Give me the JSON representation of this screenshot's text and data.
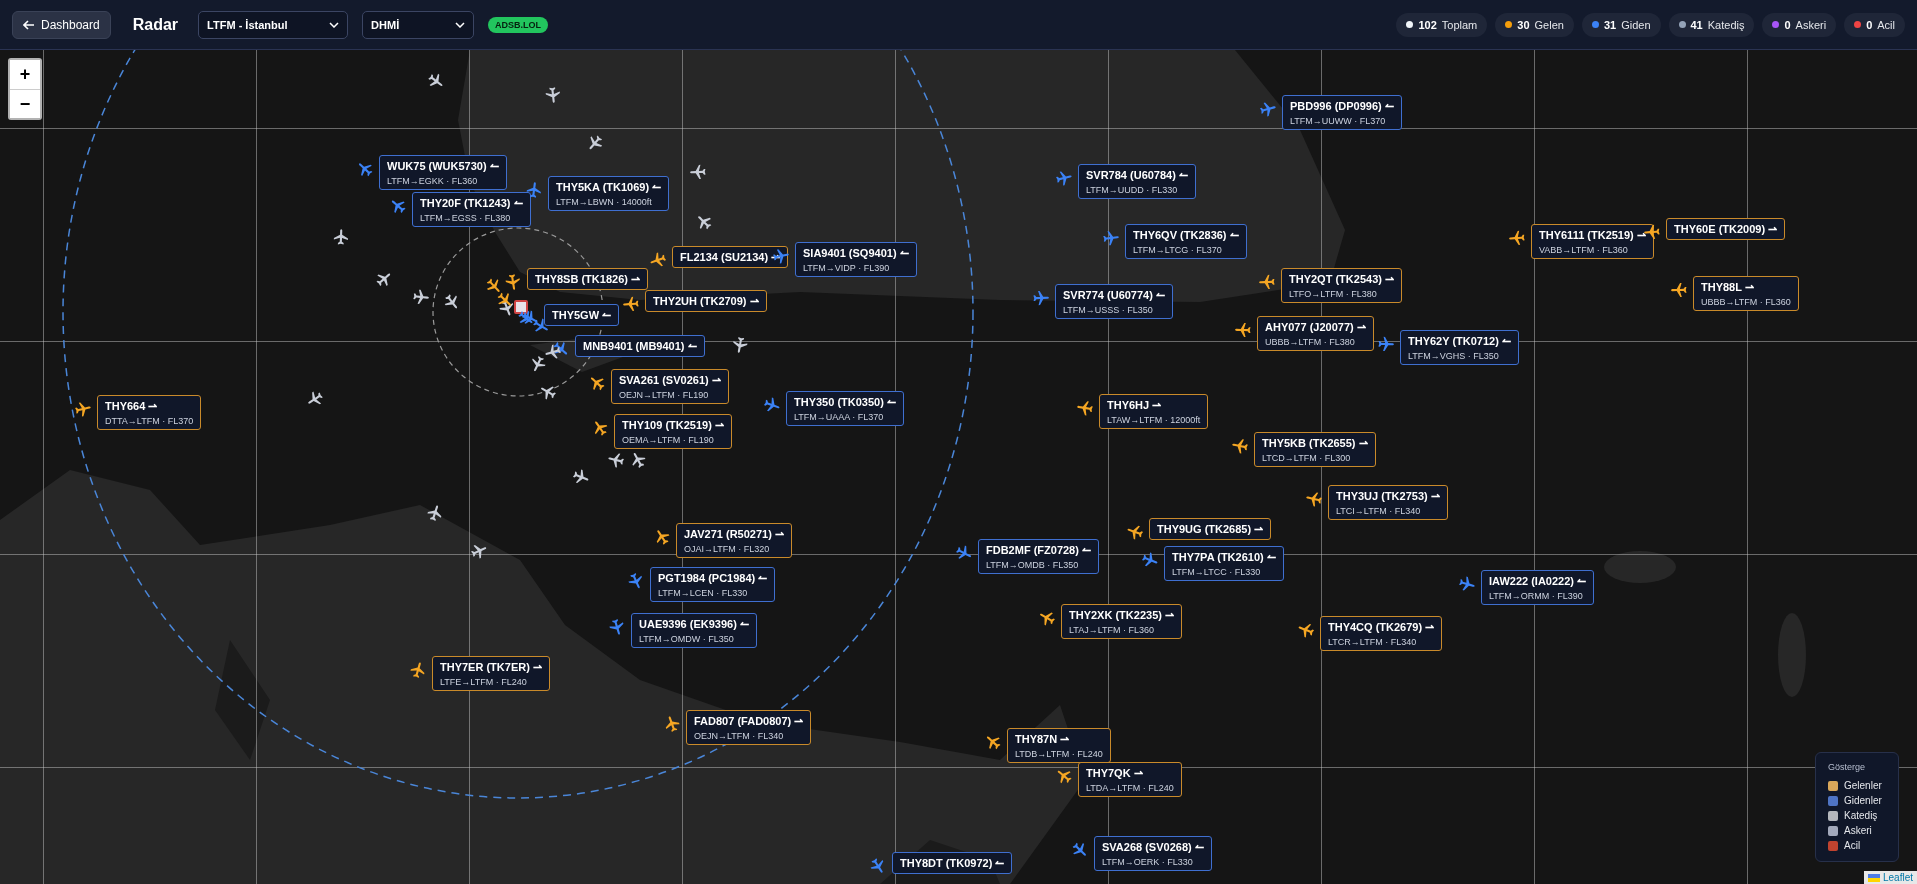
{
  "header": {
    "back_button": "Dashboard",
    "title": "Radar",
    "airport_select": "LTFM - İstanbul",
    "source_select": "DHMİ",
    "source_badge": "ADSB.LOL",
    "stats": [
      {
        "value": "102",
        "label": "Toplam",
        "color": "#f1f5f9"
      },
      {
        "value": "30",
        "label": "Gelen",
        "color": "#f59e0b"
      },
      {
        "value": "31",
        "label": "Giden",
        "color": "#3b82f6"
      },
      {
        "value": "41",
        "label": "Katediş",
        "color": "#94a3b8"
      },
      {
        "value": "0",
        "label": "Askeri",
        "color": "#a855f7"
      },
      {
        "value": "0",
        "label": "Acil",
        "color": "#ef4444"
      }
    ]
  },
  "map": {
    "zoom_in": "+",
    "zoom_out": "−",
    "flights": [
      {
        "kind": "departure",
        "title": "WUK75 (WUK5730) ↼",
        "route": "LTFM→EGKK · FL360"
      },
      {
        "kind": "departure",
        "title": "THY20F (TK1243) ↼",
        "route": "LTFM→EGSS · FL380"
      },
      {
        "kind": "departure",
        "title": "THY5KA (TK1069) ↼",
        "route": "LTFM→LBWN · 14000ft"
      },
      {
        "kind": "arrival",
        "title": "FL2134 (SU2134) ⇀"
      },
      {
        "kind": "departure",
        "title": "SIA9401 (SQ9401) ↼",
        "route": "LTFM→VIDP · FL390"
      },
      {
        "kind": "arrival",
        "title": "THY8SB (TK1826) ⇀"
      },
      {
        "kind": "arrival",
        "title": "THY2UH (TK2709) ⇀"
      },
      {
        "kind": "departure",
        "title": "THY5GW ↼"
      },
      {
        "kind": "departure",
        "title": "MNB9401 (MB9401) ↼"
      },
      {
        "kind": "arrival",
        "title": "SVA261 (SV0261) ⇀",
        "route": "OEJN→LTFM · FL190"
      },
      {
        "kind": "arrival",
        "title": "THY109 (TK2519) ⇀",
        "route": "OEMA→LTFM · FL190"
      },
      {
        "kind": "arrival",
        "title": "THY664 ⇀",
        "route": "DTTA→LTFM · FL370"
      },
      {
        "kind": "departure",
        "title": "THY350 (TK0350) ↼",
        "route": "LTFM→UAAA · FL370"
      },
      {
        "kind": "departure",
        "title": "PBD996 (DP0996) ↼",
        "route": "LTFM→UUWW · FL370"
      },
      {
        "kind": "departure",
        "title": "SVR784 (U60784) ↼",
        "route": "LTFM→UUDD · FL330"
      },
      {
        "kind": "departure",
        "title": "THY6QV (TK2836) ↼",
        "route": "LTFM→LTCG · FL370"
      },
      {
        "kind": "departure",
        "title": "SVR774 (U60774) ↼",
        "route": "LTFM→USSS · FL350"
      },
      {
        "kind": "arrival",
        "title": "THY2QT (TK2543) ⇀",
        "route": "LTFO→LTFM · FL380"
      },
      {
        "kind": "arrival",
        "title": "AHY077 (J20077) ⇀",
        "route": "UBBB→LTFM · FL380"
      },
      {
        "kind": "departure",
        "title": "THY62Y (TK0712) ↼",
        "route": "LTFM→VGHS · FL350"
      },
      {
        "kind": "arrival",
        "title": "THY6111 (TK2519) ⇀",
        "route": "VABB→LTFM · FL360"
      },
      {
        "kind": "arrival",
        "title": "THY60E (TK2009) ⇀"
      },
      {
        "kind": "arrival",
        "title": "THY88L ⇀",
        "route": "UBBB→LTFM · FL360"
      },
      {
        "kind": "arrival",
        "title": "THY6HJ ⇀",
        "route": "LTAW→LTFM · 12000ft"
      },
      {
        "kind": "arrival",
        "title": "THY5KB (TK2655) ⇀",
        "route": "LTCD→LTFM · FL300"
      },
      {
        "kind": "arrival",
        "title": "THY3UJ (TK2753) ⇀",
        "route": "LTCI→LTFM · FL340"
      },
      {
        "kind": "arrival",
        "title": "THY9UG (TK2685) ⇀"
      },
      {
        "kind": "departure",
        "title": "THY7PA (TK2610) ↼",
        "route": "LTFM→LTCC · FL330"
      },
      {
        "kind": "departure",
        "title": "FDB2MF (FZ0728) ↼",
        "route": "LTFM→OMDB · FL350"
      },
      {
        "kind": "departure",
        "title": "IAW222 (IA0222) ↼",
        "route": "LTFM→ORMM · FL390"
      },
      {
        "kind": "arrival",
        "title": "THY2XK (TK2235) ⇀",
        "route": "LTAJ→LTFM · FL360"
      },
      {
        "kind": "arrival",
        "title": "THY4CQ (TK2679) ⇀",
        "route": "LTCR→LTFM · FL340"
      },
      {
        "kind": "arrival",
        "title": "JAV271 (R50271) ⇀",
        "route": "OJAI→LTFM · FL320"
      },
      {
        "kind": "departure",
        "title": "PGT1984 (PC1984) ↼",
        "route": "LTFM→LCEN · FL330"
      },
      {
        "kind": "departure",
        "title": "UAE9396 (EK9396) ↼",
        "route": "LTFM→OMDW · FL350"
      },
      {
        "kind": "arrival",
        "title": "THY7ER (TK7ER) ⇀",
        "route": "LTFE→LTFM · FL240"
      },
      {
        "kind": "arrival",
        "title": "FAD807 (FAD0807) ⇀",
        "route": "OEJN→LTFM · FL340"
      },
      {
        "kind": "arrival",
        "title": "THY87N ⇀",
        "route": "LTDB→LTFM · FL240"
      },
      {
        "kind": "arrival",
        "title": "THY7QK ⇀",
        "route": "LTDA→LTFM · FL240"
      },
      {
        "kind": "departure",
        "title": "SVA268 (SV0268) ↼",
        "route": "LTFM→OERK · FL330"
      },
      {
        "kind": "departure",
        "title": "THY8DT (TK0972) ↼"
      },
      {
        "kind": "overflight"
      },
      {
        "kind": "overflight"
      },
      {
        "kind": "overflight"
      },
      {
        "kind": "overflight"
      },
      {
        "kind": "overflight"
      },
      {
        "kind": "overflight"
      },
      {
        "kind": "overflight"
      },
      {
        "kind": "overflight"
      },
      {
        "kind": "overflight"
      },
      {
        "kind": "overflight"
      },
      {
        "kind": "overflight"
      },
      {
        "kind": "overflight"
      },
      {
        "kind": "overflight"
      },
      {
        "kind": "overflight"
      },
      {
        "kind": "overflight"
      },
      {
        "kind": "overflight"
      },
      {
        "kind": "overflight"
      },
      {
        "kind": "overflight"
      },
      {
        "kind": "overflight"
      },
      {
        "kind": "overflight"
      },
      {
        "kind": "arrival"
      },
      {
        "kind": "arrival"
      },
      {
        "kind": "departure"
      },
      {
        "kind": "departure"
      }
    ],
    "legend": {
      "title": "Gösterge",
      "items": [
        {
          "label": "Gelenler",
          "color": "#d9a75a"
        },
        {
          "label": "Gidenler",
          "color": "#4f74c4"
        },
        {
          "label": "Katediş",
          "color": "#b4b7bd"
        },
        {
          "label": "Askeri",
          "color": "#a3a9bb"
        },
        {
          "label": "Acil",
          "color": "#c0432f"
        }
      ]
    },
    "attribution": "Leaflet"
  }
}
